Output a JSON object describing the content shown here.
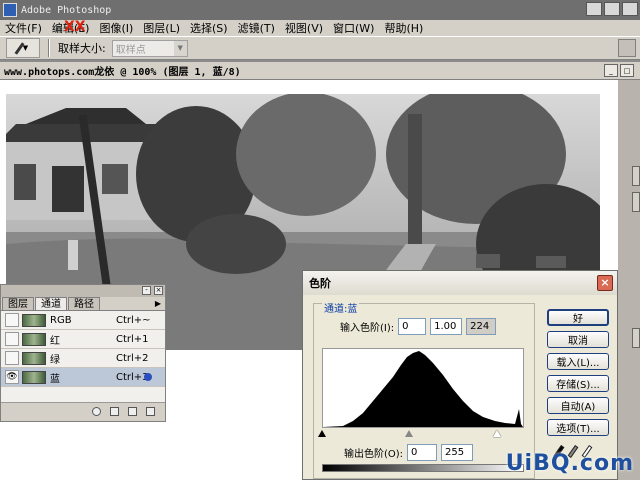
{
  "app": {
    "title": "Adobe Photoshop"
  },
  "menu": {
    "items": [
      "文件(F)",
      "编辑(E)",
      "图像(I)",
      "图层(L)",
      "选择(S)",
      "滤镜(T)",
      "视图(V)",
      "窗口(W)",
      "帮助(H)"
    ]
  },
  "watermark": "XX",
  "options": {
    "sample_size_label": "取样大小:",
    "sample_size_value": "取样点"
  },
  "document": {
    "title": "www.photops.com龙依 @ 100% (图层 1, 蓝/8)"
  },
  "channels_panel": {
    "tabs": [
      "图层",
      "通道",
      "路径"
    ],
    "active_tab": "通道",
    "rows": [
      {
        "name": "RGB",
        "shortcut": "Ctrl+~",
        "visible": false,
        "selected": false
      },
      {
        "name": "红",
        "shortcut": "Ctrl+1",
        "visible": false,
        "selected": false
      },
      {
        "name": "绿",
        "shortcut": "Ctrl+2",
        "visible": false,
        "selected": false
      },
      {
        "name": "蓝",
        "shortcut": "Ctrl+3",
        "visible": true,
        "selected": true
      }
    ]
  },
  "levels_dialog": {
    "title": "色阶",
    "channel_label": "通道:蓝",
    "input_levels_label": "输入色阶(I):",
    "input_black": "0",
    "input_gamma": "1.00",
    "input_white": "224",
    "output_levels_label": "输出色阶(O):",
    "output_black": "0",
    "output_white": "255",
    "buttons": {
      "ok": "好",
      "cancel": "取消",
      "load": "载入(L)...",
      "save": "存储(S)...",
      "auto": "自动(A)",
      "options": "选项(T)..."
    }
  },
  "site_logo": "UiBQ.com"
}
